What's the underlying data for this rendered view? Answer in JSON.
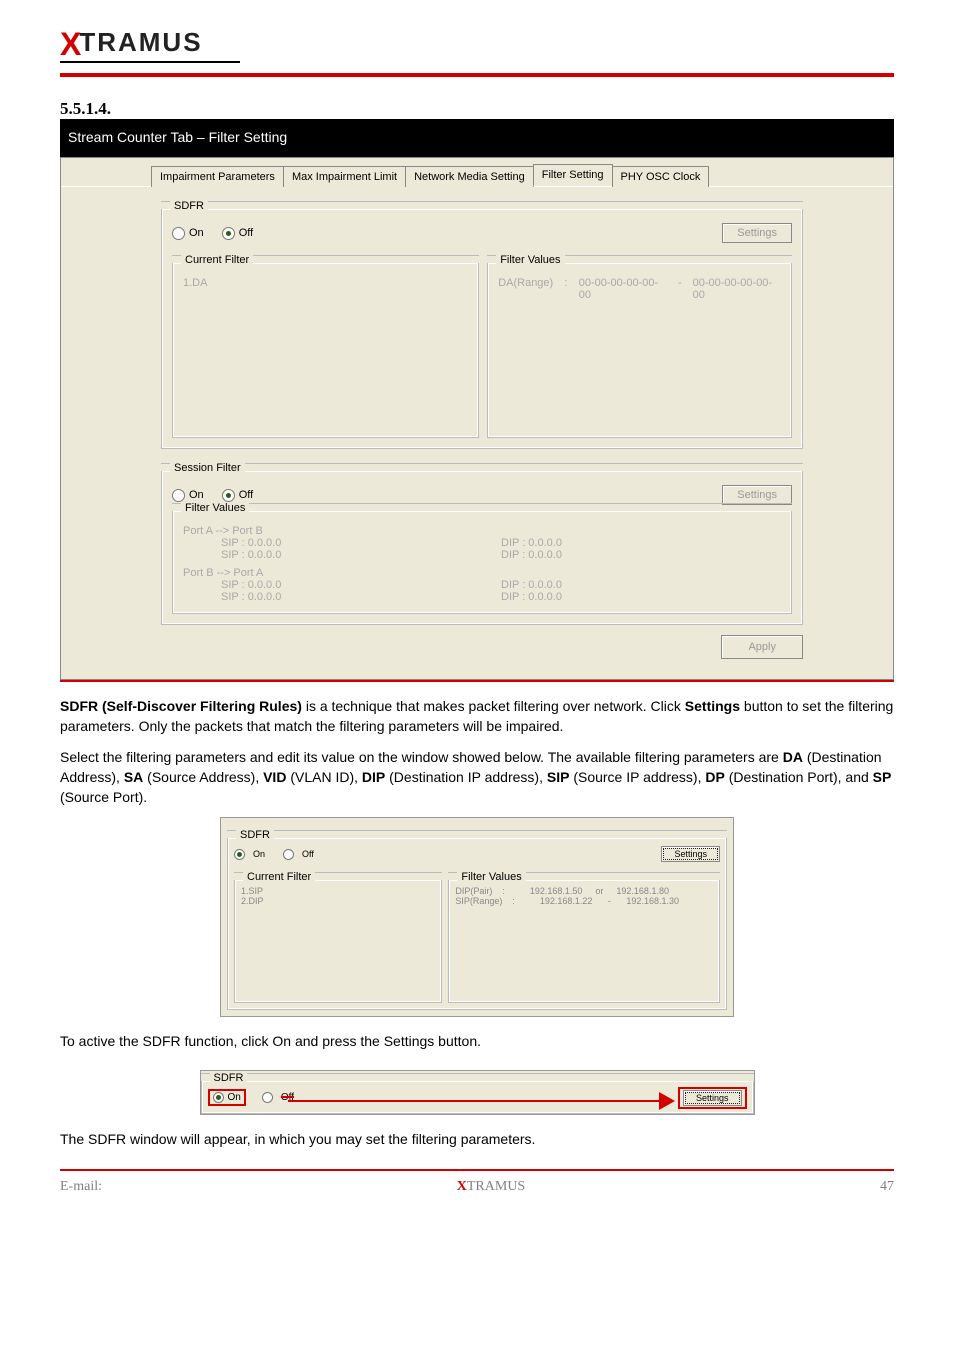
{
  "logo": {
    "x": "X",
    "rest": "TRAMUS"
  },
  "section": {
    "num": "5.5.1.4.",
    "title": "Stream Counter Tab – Filter Setting"
  },
  "screenshot_main": {
    "tabs": [
      "Impairment Parameters",
      "Max Impairment Limit",
      "Network Media Setting",
      "Filter Setting",
      "PHY OSC Clock"
    ],
    "active_tab": 3,
    "sdfr": {
      "title": "SDFR",
      "on": "On",
      "off": "Off",
      "selected": "off",
      "settings": "Settings",
      "current_filter_title": "Current Filter",
      "current_filter_items": [
        "1.DA"
      ],
      "filter_values_title": "Filter Values",
      "filter_values_lines": [
        [
          "DA(Range)",
          ":",
          "00-00-00-00-00-00",
          "-",
          "00-00-00-00-00-00"
        ]
      ]
    },
    "session": {
      "title": "Session Filter",
      "on": "On",
      "off": "Off",
      "selected": "off",
      "settings": "Settings",
      "filter_values_title": "Filter Values",
      "dir_ab": "Port A --> Port B",
      "dir_ba": "Port B --> Port A",
      "rows": [
        {
          "sip": "SIP : 0.0.0.0",
          "dip": "DIP : 0.0.0.0"
        },
        {
          "sip": "SIP : 0.0.0.0",
          "dip": "DIP : 0.0.0.0"
        },
        {
          "sip": "SIP : 0.0.0.0",
          "dip": "DIP : 0.0.0.0"
        },
        {
          "sip": "SIP : 0.0.0.0",
          "dip": "DIP : 0.0.0.0"
        }
      ]
    },
    "apply": "Apply"
  },
  "desc1_parts": {
    "p1": "SDFR (Self-Discover Filtering Rules)",
    "p2": " is a technique that makes packet filtering over network. Click ",
    "p3": "Settings",
    "p4": " button to set the filtering parameters. Only the packets that match the filtering parameters will be impaired.",
    "p5": "Select the filtering parameters and edit its value on the window showed below. The available filtering parameters are ",
    "p6": "DA",
    "p7": " (Destination Address), ",
    "p8": "SA",
    "p9": " (Source Address), ",
    "p10": "VID",
    "p11": " (VLAN ID), ",
    "p12": "DIP",
    "p13": " (Destination IP address), ",
    "p14": "SIP",
    "p15": " (Source IP address), ",
    "p16": "DP",
    "p17": " (Destination Port), and ",
    "p18": "SP",
    "p19": " (Source Port)."
  },
  "mini": {
    "title": "SDFR",
    "on": "On",
    "off": "Off",
    "selected": "on",
    "settings": "Settings",
    "current_filter_title": "Current Filter",
    "current_filter_items": [
      "1.SIP",
      "2.DIP"
    ],
    "filter_values_title": "Filter Values",
    "lines": [
      [
        "DIP(Pair)",
        ":",
        "192.168.1.50",
        "or",
        "192.168.1.80"
      ],
      [
        "SIP(Range)",
        ":",
        "192.168.1.22",
        "-",
        "192.168.1.30"
      ]
    ]
  },
  "desc2": "To active the SDFR function, click On and press the Settings button.",
  "strip": {
    "title": "SDFR",
    "on": "On",
    "off": "Off",
    "settings": "Settings"
  },
  "desc3": "The SDFR window will appear, in which you may set the filtering parameters.",
  "foot": {
    "left": "E-mail:",
    "mid_brand": "X",
    "mid_rest": "TRAMUS",
    "pageno": "47"
  }
}
